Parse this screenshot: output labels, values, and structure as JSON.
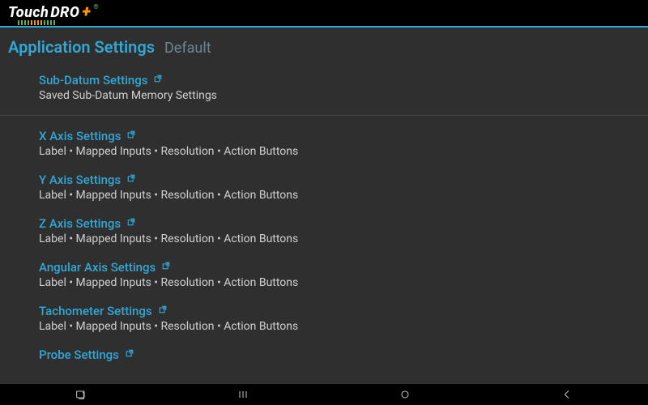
{
  "brand": {
    "left": "Touch",
    "right": "DRO",
    "plus": "+"
  },
  "header": {
    "title": "Application Settings",
    "subtitle": "Default"
  },
  "items": [
    {
      "title": "Sub-Datum Settings",
      "subtitle": "Saved Sub-Datum Memory Settings",
      "has_popout": true
    },
    {
      "title": "X Axis Settings",
      "subtitle": "Label • Mapped Inputs • Resolution • Action Buttons",
      "has_popout": true,
      "section_break_before": true
    },
    {
      "title": "Y Axis Settings",
      "subtitle": "Label • Mapped Inputs • Resolution • Action Buttons",
      "has_popout": true
    },
    {
      "title": "Z Axis Settings",
      "subtitle": "Label • Mapped Inputs • Resolution • Action Buttons",
      "has_popout": true
    },
    {
      "title": "Angular Axis Settings",
      "subtitle": "Label • Mapped Inputs • Resolution • Action Buttons",
      "has_popout": true
    },
    {
      "title": "Tachometer Settings",
      "subtitle": "Label • Mapped Inputs • Resolution • Action Buttons",
      "has_popout": true
    },
    {
      "title": "Probe Settings",
      "subtitle": "",
      "has_popout": true
    }
  ],
  "colors": {
    "accent": "#31a7d6",
    "bg": "#2f2f2f",
    "brand_plus": "#f7931e",
    "brand_tick_green": "#68b04e"
  }
}
